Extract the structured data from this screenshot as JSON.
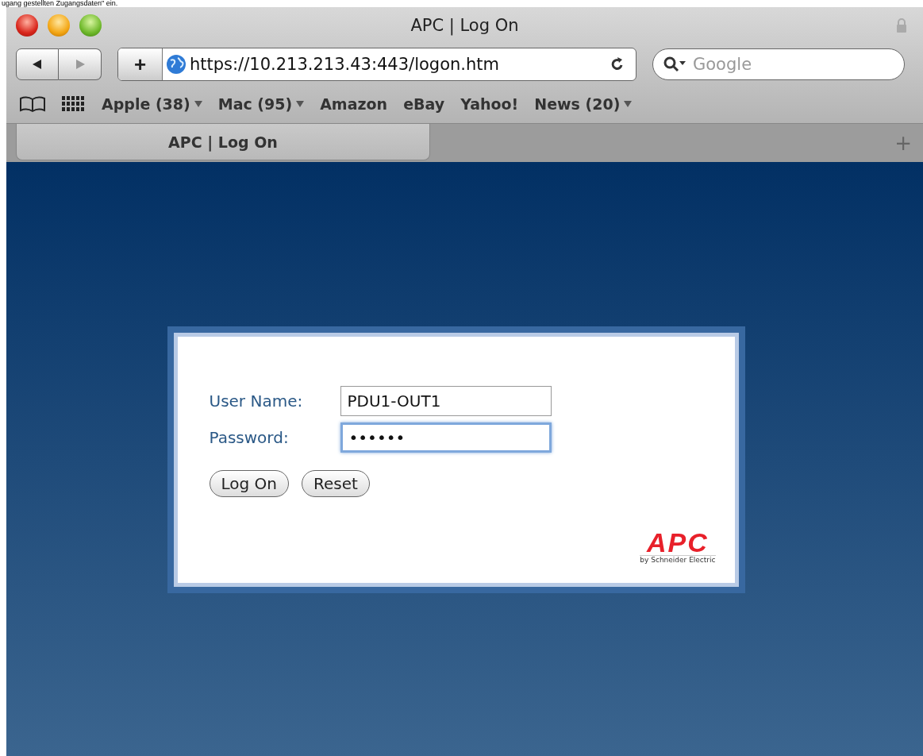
{
  "caption": "ugang gestellten Zugangsdaten\" ein.",
  "window": {
    "title": "APC | Log On",
    "locked": true
  },
  "toolbar": {
    "back_enabled": true,
    "forward_enabled": false,
    "add_label": "+",
    "url": "https://10.213.213.43:443/logon.htm",
    "search": {
      "placeholder": "Google"
    }
  },
  "bookmarks": [
    {
      "label": "Apple (38)",
      "menu": true
    },
    {
      "label": "Mac (95)",
      "menu": true
    },
    {
      "label": "Amazon",
      "menu": false
    },
    {
      "label": "eBay",
      "menu": false
    },
    {
      "label": "Yahoo!",
      "menu": false
    },
    {
      "label": "News (20)",
      "menu": true
    }
  ],
  "tabs": [
    {
      "label": "APC | Log On",
      "selected": true
    }
  ],
  "new_tab_label": "+",
  "login": {
    "fields": [
      {
        "label": "User Name:",
        "value": "PDU1-OUT1",
        "focused": false
      },
      {
        "label": "Password:",
        "value": "••••••",
        "focused": true
      }
    ],
    "buttons": [
      "Log On",
      "Reset"
    ],
    "logo": {
      "text": "APC",
      "tagline": "by Schneider Electric"
    }
  }
}
